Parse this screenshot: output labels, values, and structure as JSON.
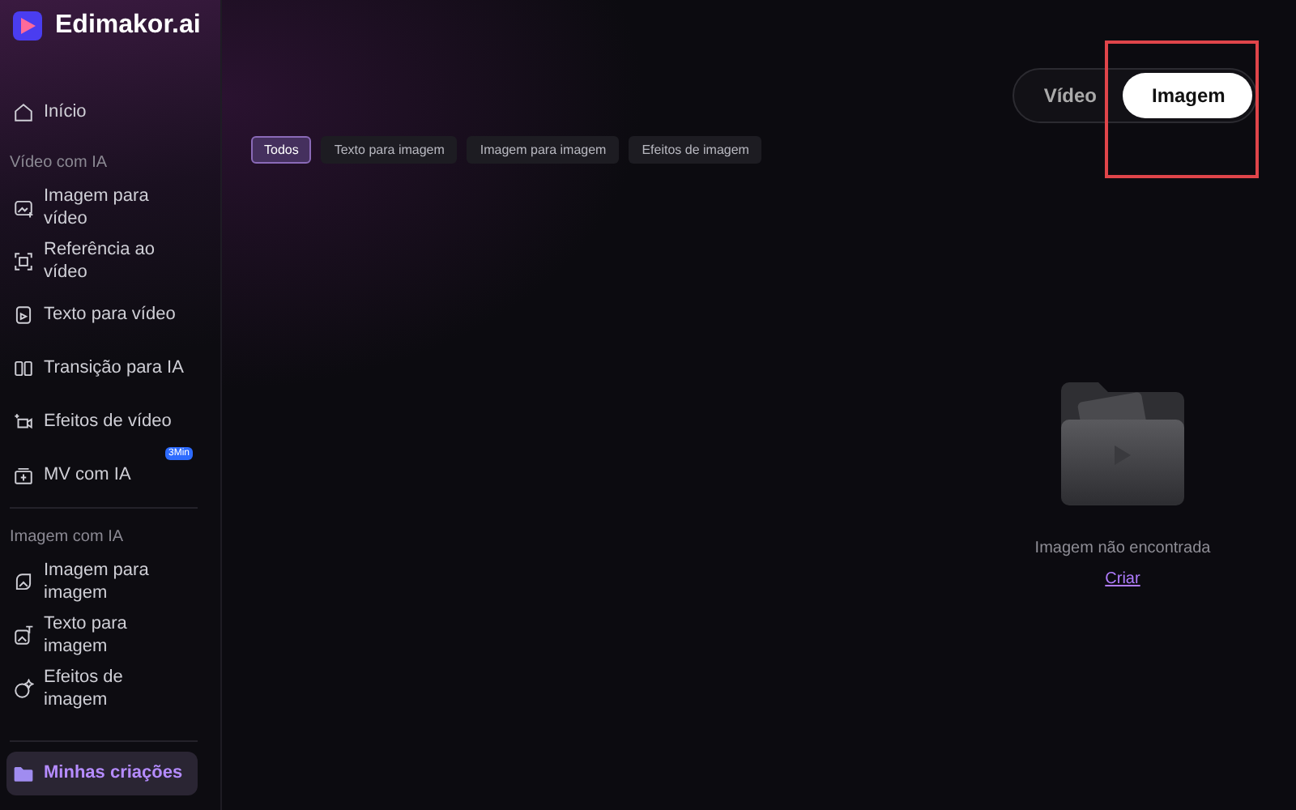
{
  "app": {
    "name": "Edimakor.ai"
  },
  "sidebar": {
    "sections": [
      {
        "items": [
          {
            "label": "Início",
            "selected": false
          }
        ]
      },
      {
        "title": "Vídeo com IA",
        "items": [
          {
            "label": "Imagem para vídeo",
            "selected": false
          },
          {
            "label": "Referência ao vídeo",
            "selected": false
          },
          {
            "label": "Texto para vídeo",
            "selected": false
          },
          {
            "label": "Transição para IA",
            "selected": false
          },
          {
            "label": "Efeitos de vídeo",
            "selected": false
          },
          {
            "label": "MV com IA",
            "selected": false,
            "badge": "3Min"
          }
        ]
      },
      {
        "title": "Imagem com IA",
        "items": [
          {
            "label": "Imagem para imagem",
            "selected": false
          },
          {
            "label": "Texto para imagem",
            "selected": false
          },
          {
            "label": "Efeitos de imagem",
            "selected": false
          }
        ]
      },
      {
        "items": [
          {
            "label": "Minhas criações",
            "selected": true
          }
        ]
      }
    ]
  },
  "mode_toggle": [
    {
      "label": "Vídeo",
      "selected": false,
      "highlighted": false
    },
    {
      "label": "Imagem",
      "selected": true,
      "highlighted": true
    }
  ],
  "filters": [
    {
      "label": "Todos",
      "selected": true
    },
    {
      "label": "Texto para imagem",
      "selected": false
    },
    {
      "label": "Imagem para imagem",
      "selected": false
    },
    {
      "label": "Efeitos de imagem",
      "selected": false
    }
  ],
  "empty_state": {
    "message": "Imagem não encontrada",
    "link": "Criar"
  }
}
